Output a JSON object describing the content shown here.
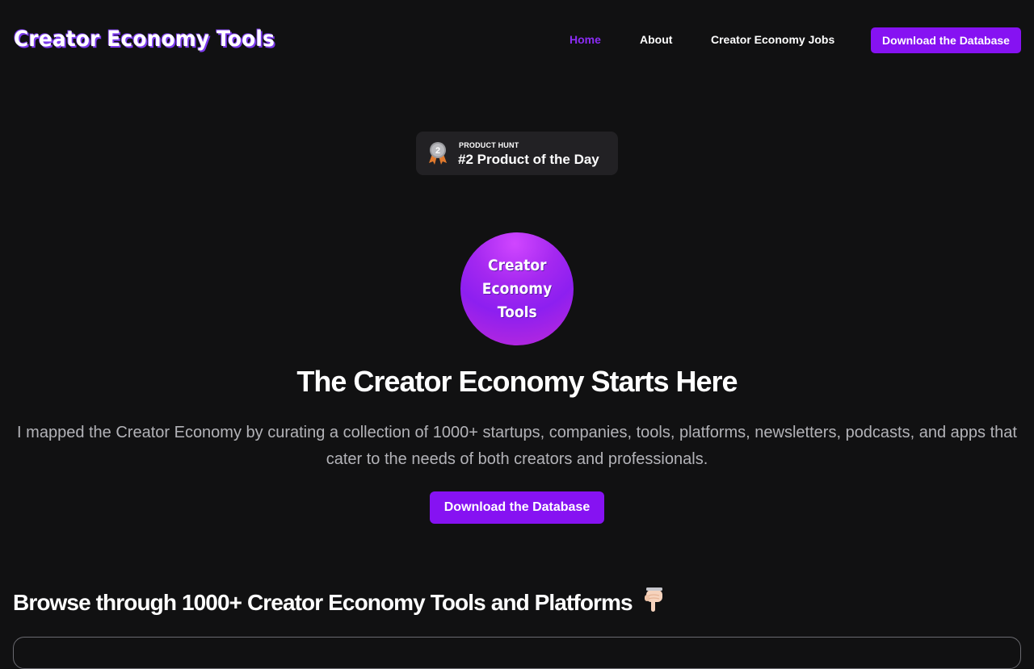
{
  "header": {
    "logo_text": "Creator Economy Tools",
    "nav": {
      "home": "Home",
      "about": "About",
      "jobs": "Creator Economy Jobs"
    },
    "cta_label": "Download the Database"
  },
  "product_hunt_badge": {
    "medal_number": "2",
    "label_small": "PRODUCT HUNT",
    "label_big": "#2 Product of the Day"
  },
  "hero": {
    "logo_lines": [
      "Creator",
      "Economy",
      "Tools"
    ],
    "title": "The Creator Economy Starts Here",
    "description": "I mapped the Creator Economy by curating a collection of 1000+ startups, companies, tools, platforms, newsletters, podcasts, and apps that cater to the needs of both creators and professionals.",
    "cta_label": "Download the Database"
  },
  "browse": {
    "title": "Browse through 1000+ Creator Economy Tools and Platforms",
    "icon": "pointing-down-hand-icon"
  },
  "colors": {
    "background": "#111112",
    "accent": "#8612f2",
    "active_link": "#8b2cf5",
    "muted_text": "#b3b3b8",
    "badge_bg": "#222124"
  }
}
